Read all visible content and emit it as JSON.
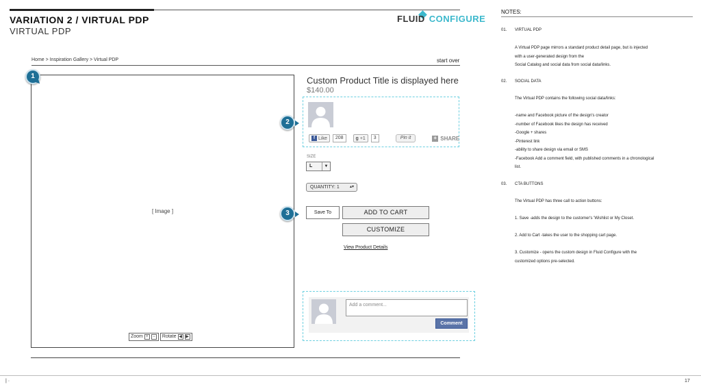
{
  "header": {
    "title": "VARIATION 2 / VIRTUAL PDP",
    "subtitle": "VIRTUAL PDP",
    "logo_word_1": "FLUID",
    "logo_word_2": "CONFIGURE"
  },
  "breadcrumb": {
    "text": "Home  >  Inspiration Gallery  >  Virtual PDP",
    "start_over": "start over"
  },
  "product": {
    "image_placeholder": "[ Image ]",
    "zoom_label": "Zoom",
    "rotate_label": "Rotate",
    "title": "Custom Product Title is displayed here",
    "price": "$140.00"
  },
  "social": {
    "like_label": "Like",
    "like_count": "208",
    "gplus_label": "+1",
    "gplus_count": "3",
    "pinit_label": "Pin it",
    "share_label": "SHARE"
  },
  "options": {
    "size_label": "SIZE",
    "size_value": "L",
    "quantity_label": "QUANTITY: 1"
  },
  "actions": {
    "save_label": "Save To",
    "add_to_cart_label": "ADD TO CART",
    "customize_label": "CUSTOMIZE",
    "view_details_label": "View Product Details"
  },
  "comments": {
    "placeholder": "Add a comment...",
    "button_label": "Comment"
  },
  "annotations": {
    "marker_1": "1",
    "marker_2": "2",
    "marker_3": "3"
  },
  "notes": {
    "title": "NOTES:",
    "items": [
      {
        "num": "01.",
        "heading": "VIRTUAL PDP",
        "body": "A Virtual PDP page mirrors a standard product detail page, but is injected\nwith a user-generated design from the\nSocial Catalog and social data from social data/links."
      },
      {
        "num": "02.",
        "heading": "SOCIAL DATA",
        "body": "The Virtual PDP contains the following social data/links:\n\n-name and Facebook picture of the design's creator\n-number of Facebook likes the design has received\n-Google + shares\n-Pinterest link\n-ability to share design via email or SMS\n-Facebook Add a comment field, with published comments in a chronological\nlist."
      },
      {
        "num": "03.",
        "heading": "CTA BUTTONS",
        "body": "The Virtual PDP has three call to action buttons:\n\n1. Save -adds the design to the customer's 'Wishlist or My Closet.\n\n2. Add to Cart -takes the user to the shopping cart page.\n\n3. Customize - opens the custom design in Fluid Configure with the\ncustomized options pre-selected."
      }
    ]
  },
  "footer": {
    "left": "|  ·",
    "page_number": "17"
  },
  "colors": {
    "accent": "#3bb8cc",
    "marker": "#1e6f96",
    "facebook": "#3b5998"
  }
}
